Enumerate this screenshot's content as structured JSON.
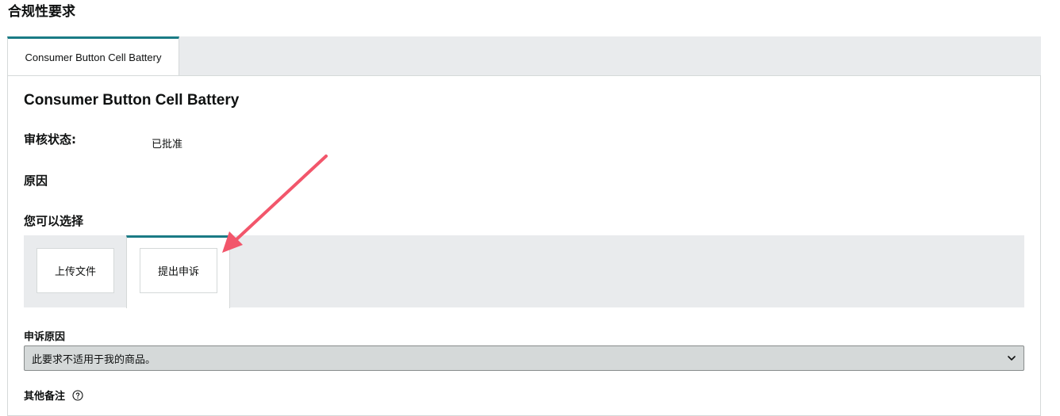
{
  "page": {
    "title": "合规性要求"
  },
  "outer_tabs": [
    {
      "label": "Consumer Button Cell Battery",
      "active": true
    }
  ],
  "card": {
    "title": "Consumer Button Cell Battery",
    "review_status_label": "审核状态:",
    "review_status_value": "已批准",
    "reason_label": "原因",
    "options_label": "您可以选择"
  },
  "options": {
    "upload": "上传文件",
    "appeal": "提出申诉",
    "active": "appeal"
  },
  "appeal_form": {
    "reason_label": "申诉原因",
    "reason_selected": "此要求不适用于我的商品。",
    "notes_label": "其他备注"
  },
  "icons": {
    "select_chevron": "chevron-down-icon",
    "notes_help": "help-circle-icon"
  },
  "colors": {
    "accent_teal": "#1a7b85",
    "tab_bar_bg": "#e9ebed",
    "select_bg": "#d5d9d9",
    "annotation_arrow": "#f2566b"
  }
}
